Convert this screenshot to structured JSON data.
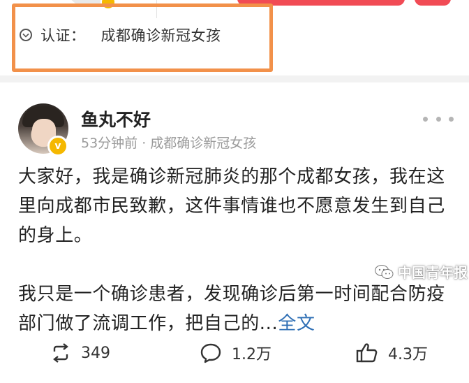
{
  "profile": {
    "verify_label": "认证：",
    "verify_value": "成都确诊新冠女孩"
  },
  "post": {
    "author": "鱼丸不好",
    "meta": "53分钟前 · 成都确诊新冠女孩",
    "paragraph1": "大家好，我是确诊新冠肺炎的那个成都女孩，我在这里向成都市民致歉，这件事情谁也不愿意发生到自己的身上。",
    "paragraph2": "我只是一个确诊患者，发现确诊后第一时间配合防疫部门做了流调工作，把自己的...",
    "full_text_link": "全文"
  },
  "actions": {
    "repost_count": "349",
    "comment_count": "1.2万",
    "like_count": "4.3万"
  },
  "watermark": {
    "text": "中国青年报"
  },
  "colors": {
    "highlight": "#f2914a",
    "brand_red": "#f14b55",
    "verified_badge": "#f5b800",
    "link": "#2f6fb5"
  },
  "icons": [
    "verified-check-icon",
    "more-dots-icon",
    "repost-icon",
    "comment-icon",
    "like-icon",
    "wechat-icon"
  ]
}
